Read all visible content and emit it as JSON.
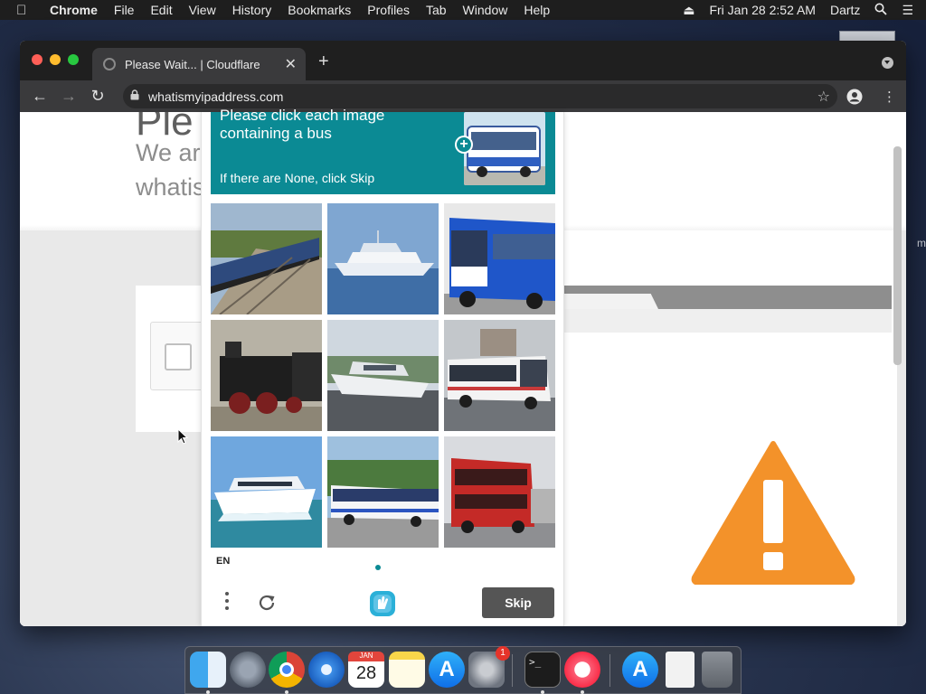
{
  "menubar": {
    "app_name": "Chrome",
    "items": [
      "File",
      "Edit",
      "View",
      "History",
      "Bookmarks",
      "Profiles",
      "Tab",
      "Window",
      "Help"
    ],
    "datetime": "Fri Jan 28  2:52 AM",
    "user": "Dartz"
  },
  "browser": {
    "tab_title": "Please Wait... | Cloudflare",
    "url": "whatismyipaddress.com"
  },
  "page": {
    "heading": "Ple",
    "subtitle_line1": "We ar",
    "subtitle_line2": "whatis",
    "right_edge_text": "m"
  },
  "captcha": {
    "prompt_line1": "Please click each image",
    "prompt_line2": "containing a bus",
    "skip_note": "If there are None, click Skip",
    "language": "EN",
    "skip_label": "Skip",
    "accent_color": "#0b8a94",
    "tiles": [
      {
        "subject": "train"
      },
      {
        "subject": "boat"
      },
      {
        "subject": "bus"
      },
      {
        "subject": "train"
      },
      {
        "subject": "boat"
      },
      {
        "subject": "bus"
      },
      {
        "subject": "boat"
      },
      {
        "subject": "bus"
      },
      {
        "subject": "bus"
      }
    ]
  },
  "dock": {
    "apps": [
      "Finder",
      "Launchpad",
      "Chrome",
      "Safari",
      "Calendar",
      "Notes",
      "App Store",
      "System Preferences",
      "Terminal",
      "Music",
      "App Store",
      "Archive",
      "Trash"
    ],
    "calendar_month": "JAN",
    "calendar_day": "28",
    "badge_count": "1"
  }
}
